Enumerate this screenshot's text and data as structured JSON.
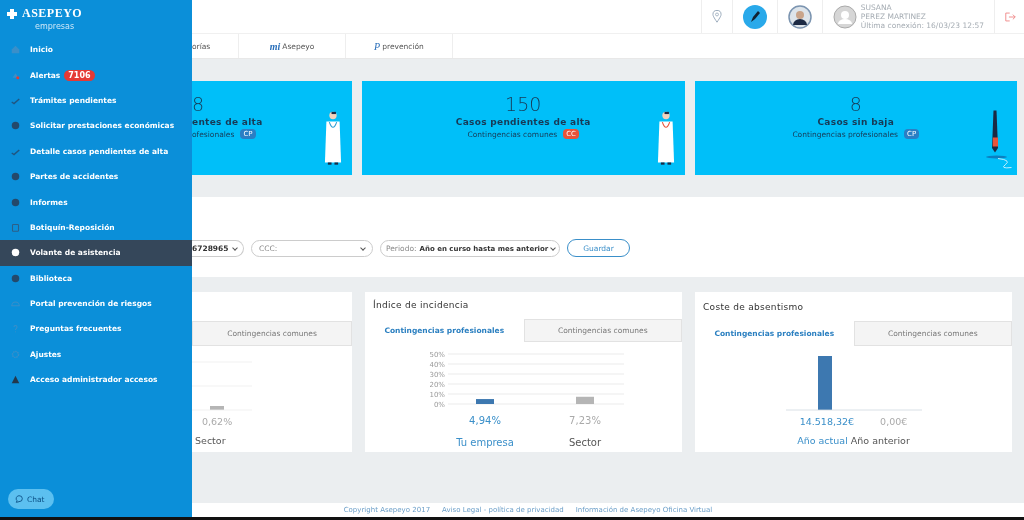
{
  "sidebar": {
    "logo": "ASEPEYO",
    "subtitle": "empresas",
    "items": [
      {
        "label": "Inicio",
        "selected": false
      },
      {
        "label": "Alertas",
        "selected": false,
        "badge": "7106"
      },
      {
        "label": "Trámites pendientes",
        "selected": false
      },
      {
        "label": "Solicitar prestaciones económicas",
        "selected": false
      },
      {
        "label": "Detalle casos pendientes de alta",
        "selected": false
      },
      {
        "label": "Partes de accidentes",
        "selected": false
      },
      {
        "label": "Informes",
        "selected": false
      },
      {
        "label": "Botiquín-Reposición",
        "selected": false
      },
      {
        "label": "Volante de asistencia",
        "selected": true
      },
      {
        "label": "Biblioteca",
        "selected": false
      },
      {
        "label": "Portal prevención de riesgos",
        "selected": false
      },
      {
        "label": "Preguntas frecuentes",
        "selected": false
      },
      {
        "label": "Ajustes",
        "selected": false
      },
      {
        "label": "Acceso administrador accesos",
        "selected": false
      }
    ],
    "chat": "Chat"
  },
  "header": {
    "user_first": "SUSANA",
    "user_last": "PEREZ MARTINEZ",
    "last_connection": "Última conexión: 16/03/23 12:57"
  },
  "tabs": [
    {
      "label": "orías"
    },
    {
      "label": "Asepeyo",
      "prefix": "mi"
    },
    {
      "label": "prevención",
      "prefix": "P"
    }
  ],
  "cards": [
    {
      "count": "8",
      "title": "entes de alta",
      "subtitle": "ofesionales",
      "tag": "CP",
      "color": "#2a7fc4"
    },
    {
      "count": "150",
      "title": "Casos pendientes de alta",
      "subtitle": "Contingencias comunes",
      "tag": "CC",
      "color": "#e8533a"
    },
    {
      "count": "8",
      "title": "Casos sin baja",
      "subtitle": "Contingencias profesionales",
      "tag": "CP",
      "color": "#2a7fc4"
    }
  ],
  "filters": {
    "company": "6728965",
    "ccc_placeholder": "CCC:",
    "period_label": "Periodo:",
    "period_value": "Año en curso hasta mes anterior",
    "save": "Guardar"
  },
  "panels": [
    {
      "tabs": [
        {
          "label": "Contingencias comunes",
          "selected": false
        }
      ],
      "values": [
        "0,62%"
      ],
      "labels": [
        "Sector"
      ],
      "kind": "partial"
    },
    {
      "title": "Índice de incidencia",
      "tabs": [
        {
          "label": "Contingencias profesionales",
          "selected": true
        },
        {
          "label": "Contingencias comunes",
          "selected": false
        }
      ],
      "kind": "chart",
      "chart_data": {
        "type": "bar",
        "categories": [
          "Tu empresa",
          "Sector"
        ],
        "values": [
          4.94,
          7.23
        ],
        "ylim": [
          0,
          50
        ],
        "grid": true,
        "yticks": [
          {
            "value": 0,
            "label": "0%"
          },
          {
            "value": 10,
            "label": "10%"
          },
          {
            "value": 20,
            "label": "20%"
          },
          {
            "value": 30,
            "label": "30%"
          },
          {
            "value": 40,
            "label": "40%"
          },
          {
            "value": 50,
            "label": "50%"
          }
        ],
        "value_labels": [
          "4,94%",
          "7,23%"
        ]
      }
    },
    {
      "title": "Coste de absentismo",
      "tabs": [
        {
          "label": "Contingencias profesionales",
          "selected": true
        },
        {
          "label": "Contingencias comunes",
          "selected": false
        }
      ],
      "values": [
        "14.518,32€",
        "0,00€"
      ],
      "labels": [
        "Año actual",
        "Año anterior"
      ],
      "kind": "cost"
    }
  ],
  "footer": [
    "Copyright Asepeyo 2017",
    "Aviso Legal - política de privacidad",
    "Información de Asepeyo Oficina Virtual"
  ]
}
